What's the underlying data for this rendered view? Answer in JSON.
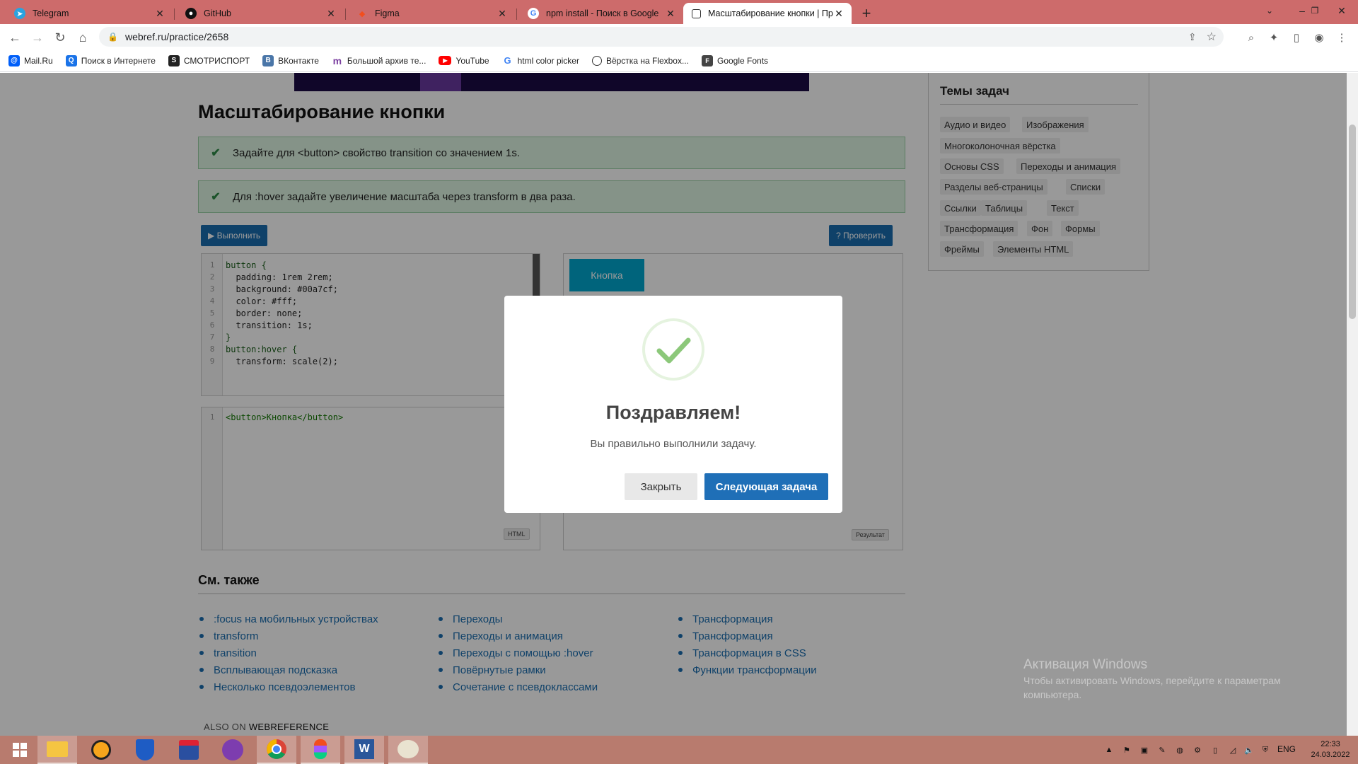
{
  "browser": {
    "tabs": [
      {
        "label": "Telegram",
        "icon": "telegram-icon",
        "color": "#2aa3df"
      },
      {
        "label": "GitHub",
        "icon": "github-icon",
        "color": "#111111"
      },
      {
        "label": "Figma",
        "icon": "figma-icon",
        "color": "#f24e1e"
      },
      {
        "label": "npm install - Поиск в Google",
        "icon": "google-icon",
        "color": "#4285f4"
      },
      {
        "label": "Масштабирование кнопки | Пр",
        "icon": "page-icon",
        "color": "#333333",
        "active": true
      }
    ],
    "url": "webref.ru/practice/2658",
    "bookmarks": [
      {
        "label": "Mail.Ru",
        "icon": "mailru-icon",
        "color": "#005ff9"
      },
      {
        "label": "Поиск в Интернете",
        "icon": "search-icon",
        "color": "#1a73e8"
      },
      {
        "label": "СМОТРИСПОРТ",
        "icon": "smotrisport-icon",
        "color": "#222222"
      },
      {
        "label": "ВКонтакте",
        "icon": "vk-icon",
        "color": "#4a76a8"
      },
      {
        "label": "Большой архив те...",
        "icon": "archive-icon",
        "color": "#7b3fa0"
      },
      {
        "label": "YouTube",
        "icon": "youtube-icon",
        "color": "#ff0000"
      },
      {
        "label": "html color picker",
        "icon": "google-icon",
        "color": "#4285f4"
      },
      {
        "label": "Вёрстка на Flexbox...",
        "icon": "flexbox-icon",
        "color": "#333333"
      },
      {
        "label": "Google Fonts",
        "icon": "google-fonts-icon",
        "color": "#444444"
      }
    ]
  },
  "page": {
    "title": "Масштабирование кнопки",
    "tasks": [
      "Задайте для <button> свойство transition со значением 1s.",
      "Для :hover задайте увеличение масштаба через transform в два раза."
    ],
    "run_label": "▶ Выполнить",
    "check_label": "? Проверить",
    "css_lines": [
      {
        "num": "1",
        "code": "button {"
      },
      {
        "num": "2",
        "code": "  padding: 1rem 2rem;"
      },
      {
        "num": "3",
        "code": "  background: #00a7cf;"
      },
      {
        "num": "4",
        "code": "  color: #fff;"
      },
      {
        "num": "5",
        "code": "  border: none;"
      },
      {
        "num": "6",
        "code": "  transition: 1s;"
      },
      {
        "num": "7",
        "code": "}"
      },
      {
        "num": "8",
        "code": "button:hover {"
      },
      {
        "num": "9",
        "code": "  transform: scale(2);"
      }
    ],
    "html_lines": [
      {
        "num": "1",
        "code": "<button>Кнопка</button>"
      }
    ],
    "html_hint": "HTML",
    "result_button": "Кнопка",
    "result_hint": "Результат",
    "see_also_title": "См. также",
    "see_also_cols": [
      [
        ":focus на мобильных устройствах",
        "transform",
        "transition",
        "Всплывающая подсказка",
        "Несколько псевдоэлементов"
      ],
      [
        "Переходы",
        "Переходы и анимация",
        "Переходы с помощью :hover",
        "Повёрнутые рамки",
        "Сочетание с псевдоклассами"
      ],
      [
        "Трансформация",
        "Трансформация",
        "Трансформация в CSS",
        "Функции трансформации"
      ]
    ],
    "also_on": "ALSO ON ",
    "also_on_brand": "WEBREFERENCE"
  },
  "sidebar": {
    "title": "Темы задач",
    "topics": [
      "Аудио и видео",
      "Изображения",
      "Многоколоночная вёрстка",
      "Основы CSS",
      "Переходы и анимация",
      "Разделы веб-страницы",
      "Списки",
      "Ссылки",
      "Таблицы",
      "Текст",
      "Трансформация",
      "Фон",
      "Формы",
      "Фреймы",
      "Элементы HTML"
    ]
  },
  "modal": {
    "title": "Поздравляем!",
    "subtitle": "Вы правильно выполнили задачу.",
    "close_label": "Закрыть",
    "next_label": "Следующая задача",
    "success_color": "#8cc87a"
  },
  "watermark": {
    "title": "Активация Windows",
    "text": "Чтобы активировать Windows, перейдите к параметрам компьютера."
  },
  "taskbar": {
    "apps": [
      "start-icon",
      "file-explorer-icon",
      "avast-icon",
      "defender-icon",
      "floppy-icon",
      "viber-icon",
      "chrome-icon",
      "figma-icon",
      "word-icon",
      "paint-icon"
    ],
    "lang": "ENG",
    "time": "22:33",
    "date": "24.03.2022"
  },
  "colors": {
    "accent": "#1a6db0",
    "tab_bar": "#cd6b6b",
    "taskbar": "#b87b6e",
    "task_ok_bg": "#def5e3"
  }
}
